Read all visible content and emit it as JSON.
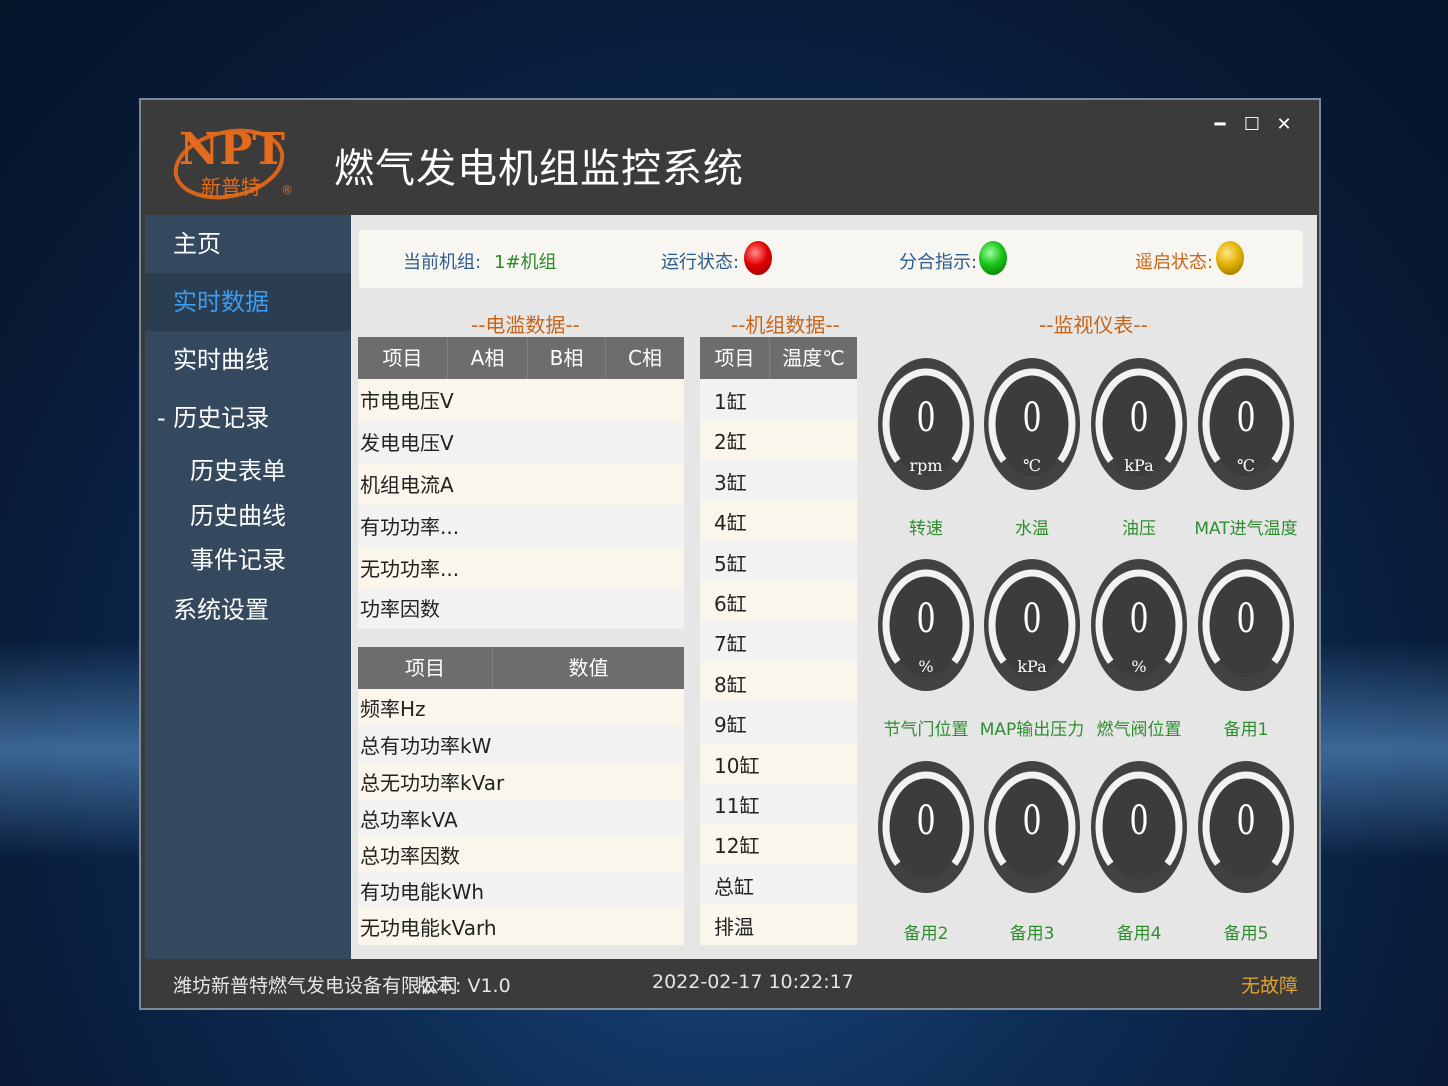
{
  "app": {
    "title": "燃气发电机组监控系统",
    "logo_text": "NPT",
    "logo_sub": "新普特",
    "logo_mark": "®"
  },
  "window_controls": {
    "minimize": "━",
    "maximize": "☐",
    "close": "✕"
  },
  "sidebar": {
    "items": [
      {
        "label": "主页"
      },
      {
        "label": "实时数据"
      },
      {
        "label": "实时曲线"
      },
      {
        "label": "- 历史记录"
      },
      {
        "label": "系统设置"
      }
    ],
    "sub_items": [
      {
        "label": "历史表单"
      },
      {
        "label": "历史曲线"
      },
      {
        "label": "事件记录"
      }
    ]
  },
  "status": {
    "unit_label": "当前机组:",
    "unit_value": "1#机组",
    "run_label": "运行状态:",
    "switch_label": "分合指示:",
    "remote_label": "遥启状态:",
    "colors": {
      "run": "#e00000",
      "switch": "#16c216",
      "remote": "#e0b000"
    }
  },
  "sections": {
    "electric": "--电滥数据--",
    "unit": "--机组数据--",
    "meters": "--监视仪表--"
  },
  "phase_table": {
    "headers": [
      "项目",
      "A相",
      "B相",
      "C相"
    ],
    "rows": [
      "市电电压V",
      "发电电压V",
      "机组电流A",
      "有功功率...",
      "无功功率...",
      "功率因数"
    ]
  },
  "total_table": {
    "headers": [
      "项目",
      "数值"
    ],
    "rows": [
      "频率Hz",
      "总有功功率kW",
      "总无功功率kVar",
      "总功率kVA",
      "总功率因数",
      "有功电能kWh",
      "无功电能kVarh"
    ]
  },
  "unit_table": {
    "headers": [
      "项目",
      "温度℃"
    ],
    "rows": [
      "1缸",
      "2缸",
      "3缸",
      "4缸",
      "5缸",
      "6缸",
      "7缸",
      "8缸",
      "9缸",
      "10缸",
      "11缸",
      "12缸",
      "总缸",
      "排温"
    ]
  },
  "gauges": [
    {
      "value": "0",
      "unit": "rpm",
      "label": "转速",
      "level": 0
    },
    {
      "value": "0",
      "unit": "℃",
      "label": "水温",
      "level": 0
    },
    {
      "value": "0",
      "unit": "kPa",
      "label": "油压",
      "level": 0
    },
    {
      "value": "0",
      "unit": "℃",
      "label": "MAT进气温度",
      "level": 0
    },
    {
      "value": "0",
      "unit": "%",
      "label": "节气门位置",
      "level": 0
    },
    {
      "value": "0",
      "unit": "kPa",
      "label": "MAP输出压力",
      "level": 0
    },
    {
      "value": "0",
      "unit": "%",
      "label": "燃气阀位置",
      "level": 0
    },
    {
      "value": "0",
      "unit": "",
      "label": "备用1",
      "level": 0
    },
    {
      "value": "0",
      "unit": "",
      "label": "备用2",
      "level": 0
    },
    {
      "value": "0",
      "unit": "",
      "label": "备用3",
      "level": 0
    },
    {
      "value": "0",
      "unit": "",
      "label": "备用4",
      "level": 0
    },
    {
      "value": "0",
      "unit": "",
      "label": "备用5",
      "level": 0
    }
  ],
  "footer": {
    "company": "潍坊新普特燃气发电设备有限公司",
    "version": "版本:  V1.0",
    "datetime": "2022-02-17 10:22:17",
    "fault_status": "无故障"
  }
}
